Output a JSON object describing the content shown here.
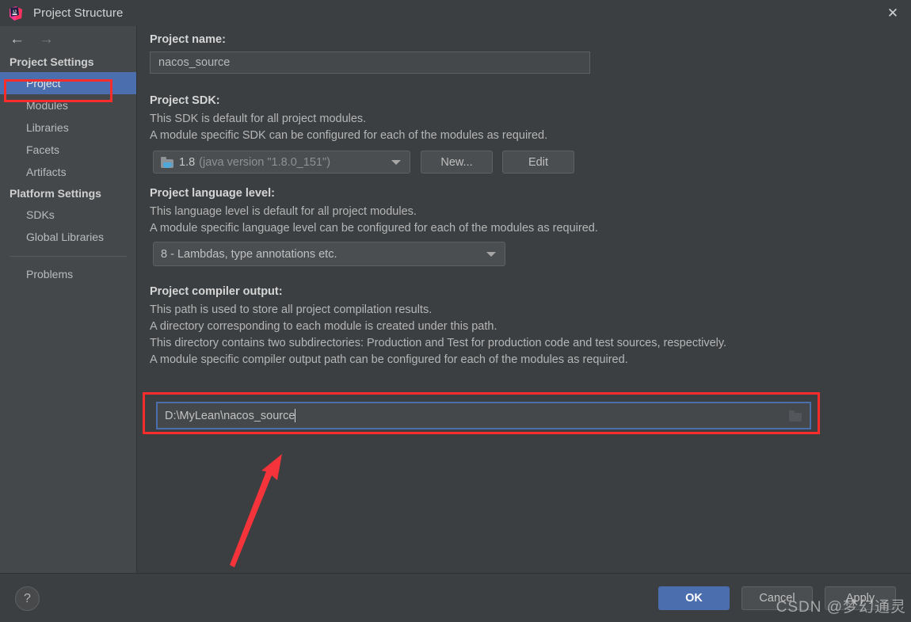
{
  "window": {
    "title": "Project Structure",
    "logo_icon": "intellij-idea-logo",
    "close_icon": "✕"
  },
  "sidebar": {
    "nav": {
      "back_icon": "←",
      "forward_icon": "→"
    },
    "groups": [
      {
        "title": "Project Settings",
        "items": [
          {
            "label": "Project",
            "selected": true
          },
          {
            "label": "Modules",
            "selected": false
          },
          {
            "label": "Libraries",
            "selected": false
          },
          {
            "label": "Facets",
            "selected": false
          },
          {
            "label": "Artifacts",
            "selected": false
          }
        ]
      },
      {
        "title": "Platform Settings",
        "items": [
          {
            "label": "SDKs",
            "selected": false
          },
          {
            "label": "Global Libraries",
            "selected": false
          }
        ]
      }
    ],
    "extra_items": [
      {
        "label": "Problems",
        "selected": false
      }
    ],
    "selection_highlight_color": "#fb2c2c",
    "selection_bg_color": "#4b6eaf"
  },
  "main": {
    "project_name": {
      "label": "Project name:",
      "value": "nacos_source"
    },
    "project_sdk": {
      "label": "Project SDK:",
      "descriptions": [
        "This SDK is default for all project modules.",
        "A module specific SDK can be configured for each of the modules as required."
      ],
      "icon": "java-sdk-folder-icon",
      "selected_version": "1.8",
      "selected_detail": "(java version \"1.8.0_151\")",
      "new_button": "New...",
      "edit_button": "Edit"
    },
    "project_language_level": {
      "label": "Project language level:",
      "descriptions": [
        "This language level is default for all project modules.",
        "A module specific language level can be configured for each of the modules as required."
      ],
      "selected": "8 - Lambdas, type annotations etc."
    },
    "project_compiler_output": {
      "label": "Project compiler output:",
      "descriptions": [
        "This path is used to store all project compilation results.",
        "A directory corresponding to each module is created under this path.",
        "This directory contains two subdirectories: Production and Test for production code and test sources, respectively.",
        "A module specific compiler output path can be configured for each of the modules as required."
      ],
      "value": "D:\\MyLean\\nacos_source",
      "browse_icon": "folder-browse-icon",
      "highlight_color": "#fb2c2c",
      "focus_color": "#4b6fad"
    }
  },
  "annotation": {
    "arrow_color": "#f5333a",
    "arrow_name": "red-pointer-arrow"
  },
  "footer": {
    "help_icon": "?",
    "ok_label": "OK",
    "cancel_label": "Cancel",
    "apply_label": "Apply"
  },
  "watermark": {
    "text": "CSDN @梦幻通灵"
  }
}
